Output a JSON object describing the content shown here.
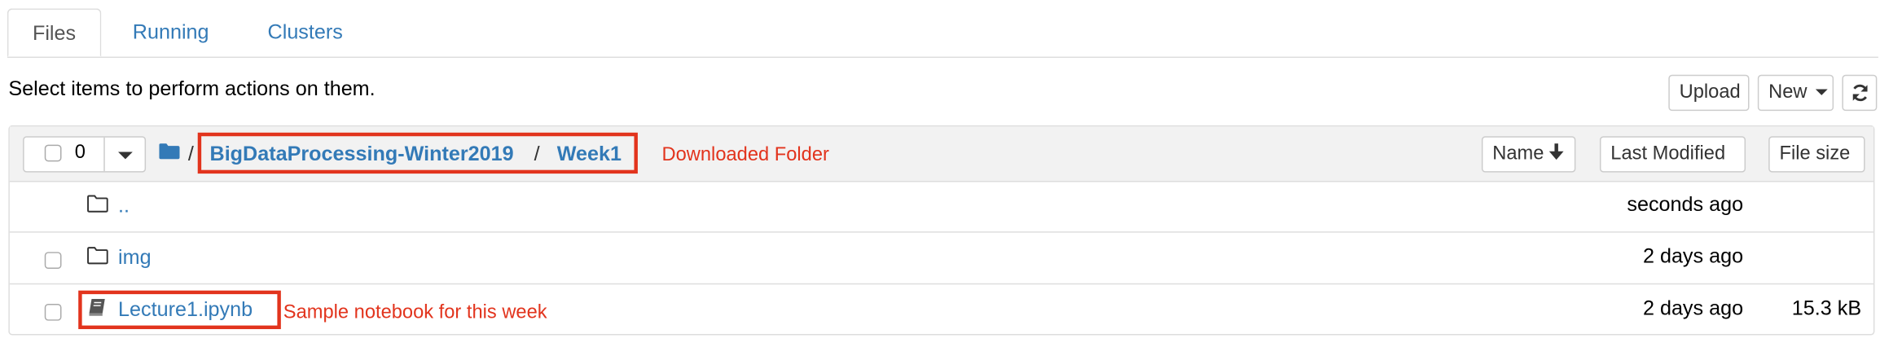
{
  "tabs": [
    {
      "label": "Files",
      "active": true
    },
    {
      "label": "Running",
      "active": false
    },
    {
      "label": "Clusters",
      "active": false
    }
  ],
  "instructions": "Select items to perform actions on them.",
  "toolbar": {
    "upload_label": "Upload",
    "new_label": "New"
  },
  "list_header": {
    "selected_count": "0",
    "breadcrumb": {
      "separator": "/",
      "items": [
        "BigDataProcessing-Winter2019",
        "Week1"
      ]
    },
    "annotation": "Downloaded Folder",
    "sort_name_label": "Name",
    "sort_modified_label": "Last Modified",
    "sort_size_label": "File size"
  },
  "rows": [
    {
      "name": "..",
      "type": "folder",
      "modified": "seconds ago",
      "size": ""
    },
    {
      "name": "img",
      "type": "folder",
      "modified": "2 days ago",
      "size": ""
    },
    {
      "name": "Lecture1.ipynb",
      "type": "notebook",
      "modified": "2 days ago",
      "size": "15.3 kB",
      "annotation": "Sample notebook for this week"
    }
  ],
  "colors": {
    "link": "#337ab7",
    "annotation": "#e2341d",
    "header_bg": "#f2f2f2"
  }
}
